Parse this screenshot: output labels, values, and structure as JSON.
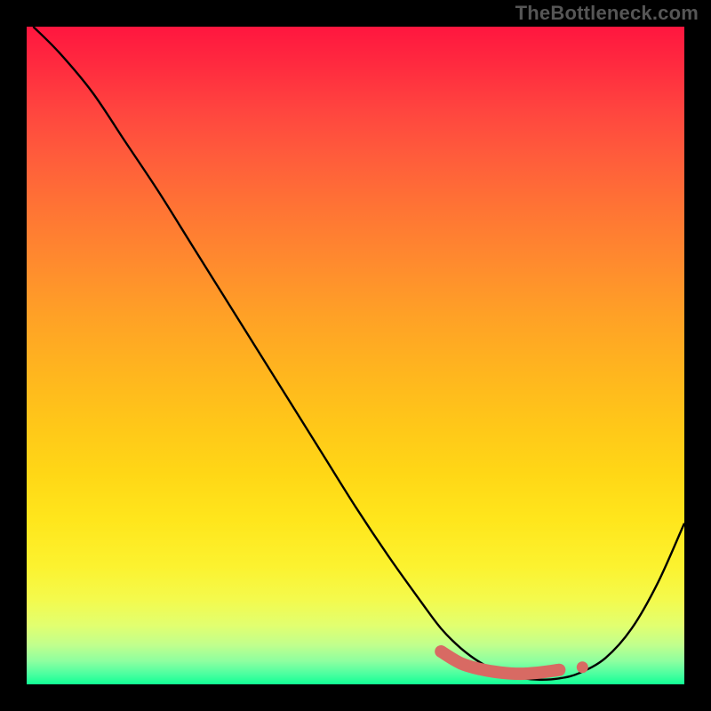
{
  "watermark": "TheBottleneck.com",
  "chart_data": {
    "type": "line",
    "title": "",
    "xlabel": "",
    "ylabel": "",
    "xlim": [
      0,
      100
    ],
    "ylim": [
      0,
      100
    ],
    "grid": false,
    "series": [
      {
        "name": "curve",
        "color": "#000000",
        "x": [
          1,
          5,
          10,
          15,
          20,
          25,
          30,
          35,
          40,
          45,
          50,
          55,
          60,
          63,
          66,
          69,
          72,
          75,
          78,
          81,
          84,
          88,
          92,
          96,
          100
        ],
        "y": [
          100,
          96,
          90,
          82.5,
          75,
          67,
          59,
          51,
          43,
          35,
          27,
          19.5,
          12.5,
          8.5,
          5.5,
          3.3,
          1.8,
          1.0,
          0.7,
          0.9,
          1.7,
          4.0,
          8.5,
          15.5,
          24.5
        ]
      },
      {
        "name": "accent-band",
        "color": "#d86a63",
        "x": [
          63,
          66,
          69,
          72,
          75,
          78,
          81
        ],
        "y": [
          5.0,
          3.2,
          2.3,
          1.8,
          1.6,
          1.8,
          2.2
        ]
      }
    ],
    "accent_dot": {
      "x": 84.5,
      "y": 2.6
    }
  }
}
